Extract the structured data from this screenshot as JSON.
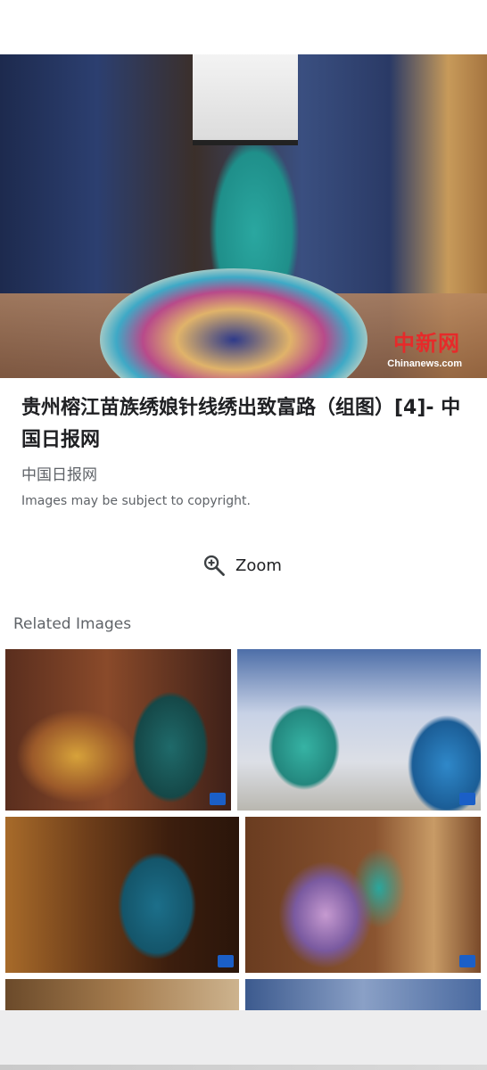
{
  "hero": {
    "image_alt": "苗族绣娘刺绣",
    "watermark_cn": "中新网",
    "watermark_en": "Chinanews.com"
  },
  "result": {
    "title": "贵州榕江苗族绣娘针线绣出致富路（组图）[4]- 中国日报网",
    "source": "中国日报网",
    "copyright": "Images may be subject to copyright."
  },
  "zoom": {
    "icon": "zoom-in-icon",
    "label": "Zoom"
  },
  "related": {
    "heading": "Related Images",
    "items": [
      {
        "alt": "embroidery woman 1"
      },
      {
        "alt": "embroidery women 2"
      },
      {
        "alt": "embroidery woman 3"
      },
      {
        "alt": "embroidery woman 4"
      },
      {
        "alt": "related 5"
      },
      {
        "alt": "related 6"
      }
    ]
  },
  "colors": {
    "text_primary": "#202124",
    "text_secondary": "#5f6368",
    "bottom_sheet": "#ededee"
  }
}
